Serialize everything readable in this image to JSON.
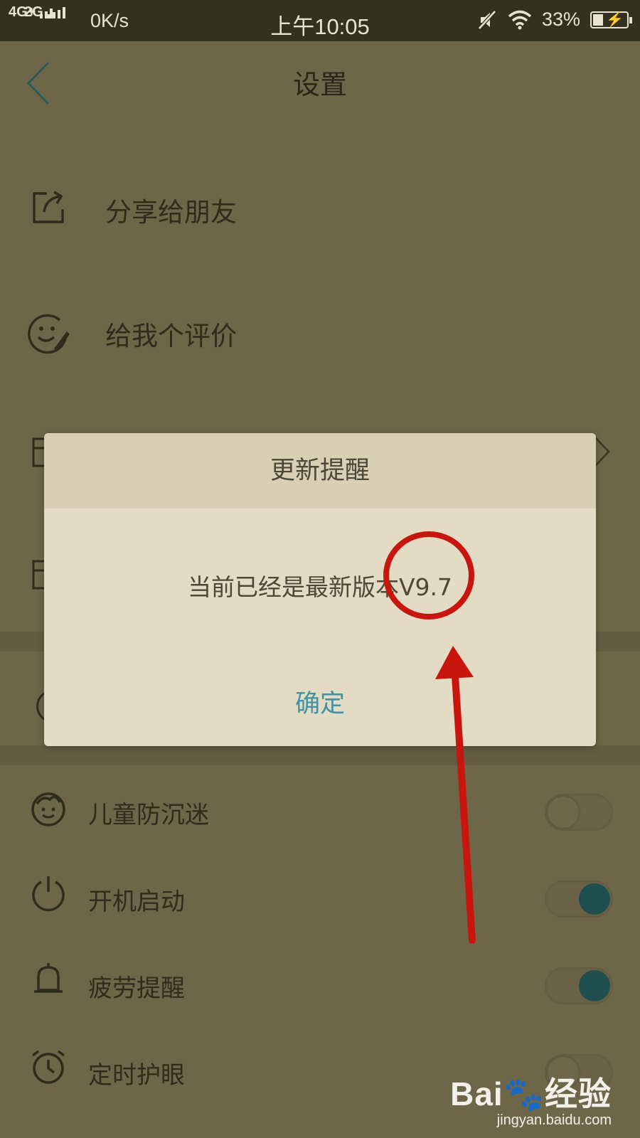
{
  "status_bar": {
    "signal_top": "4G+",
    "signal_bottom": "2G",
    "speed": "0K/s",
    "time": "上午10:05",
    "battery": "33%",
    "icons": [
      "mute-icon",
      "wifi-icon",
      "battery-icon"
    ]
  },
  "header": {
    "title": "设置",
    "back_icon": "chevron-left-icon"
  },
  "menu": {
    "share": {
      "label": "分享给朋友",
      "icon": "share-icon"
    },
    "rate": {
      "label": "给我个评价",
      "icon": "smile-edit-icon"
    }
  },
  "settings": [
    {
      "label": "儿童防沉迷",
      "icon": "child-face-icon",
      "toggle_on": false
    },
    {
      "label": "开机启动",
      "icon": "power-icon",
      "toggle_on": true
    },
    {
      "label": "疲劳提醒",
      "icon": "bell-icon",
      "toggle_on": true
    },
    {
      "label": "定时护眼",
      "icon": "alarm-icon",
      "toggle_on": false
    }
  ],
  "dialog": {
    "title": "更新提醒",
    "message": "当前已经是最新版本V9.7",
    "ok": "确定"
  },
  "watermark": {
    "brand": "Bai",
    "brand_suffix": "经验",
    "url": "jingyan.baidu.com"
  },
  "colors": {
    "accent": "#3f93a6",
    "annotation": "#c8160f",
    "toggle_on": "#1f4f4e"
  }
}
